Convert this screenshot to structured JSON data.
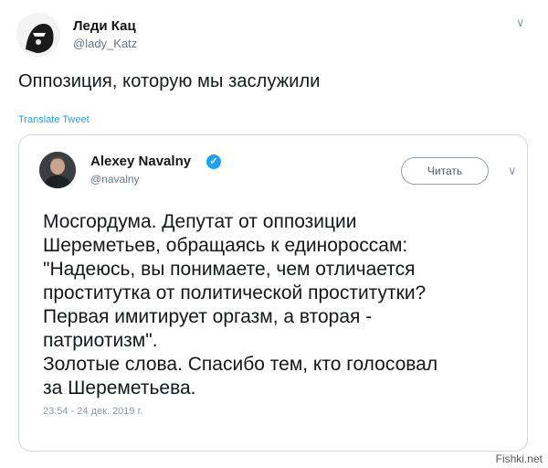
{
  "tweet": {
    "author_name": "Леди Кац",
    "author_handle": "@lady_Katz",
    "text": "Оппозиция, которую мы заслужили",
    "translate_label": "Translate Tweet"
  },
  "quoted": {
    "author_name": "Alexey Navalny",
    "author_handle": "@navalny",
    "verified": true,
    "follow_label": "Читать",
    "lines": [
      "Мосгордума. Депутат от оппозиции",
      "Шереметьев, обращаясь к единороссам:",
      "\"Надеюсь, вы понимаете, чем отличается",
      "проститутка от политической проститутки?",
      "Первая имитирует оргазм, а вторая -",
      "патриотизм\".",
      "Золотые слова. Спасибо тем, кто голосовал",
      "за Шереметьева."
    ],
    "timestamp": "23:54 - 24 дек. 2019 г."
  },
  "watermark": "Fishki.net",
  "colors": {
    "link": "#1da1f2",
    "muted": "#657786",
    "border": "#ccd6dd"
  },
  "icons": {
    "chevron": "chevron-down-icon",
    "verified": "verified-badge-icon"
  }
}
